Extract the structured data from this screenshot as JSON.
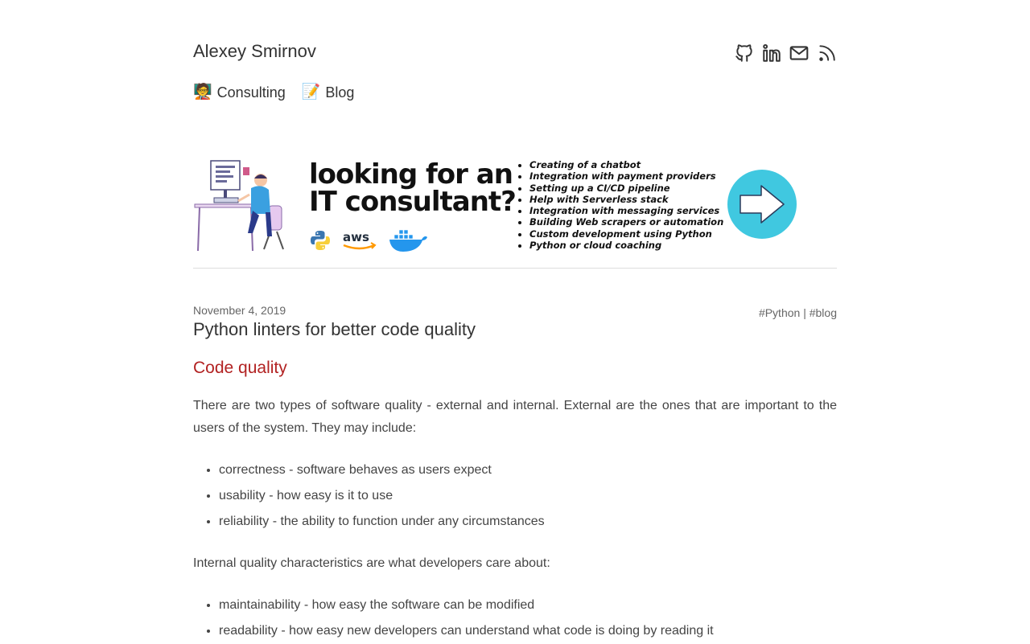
{
  "site": {
    "title": "Alexey Smirnov",
    "social": [
      "github-icon",
      "linkedin-icon",
      "mail-icon",
      "rss-icon"
    ],
    "nav": [
      {
        "emoji": "🧑‍🏫",
        "label": "Consulting"
      },
      {
        "emoji": "📝",
        "label": "Blog"
      }
    ]
  },
  "banner": {
    "headline_line1": "looking for an",
    "headline_line2": "IT consultant?",
    "services": [
      "Creating of a chatbot",
      "Integration with payment providers",
      "Setting up a CI/CD pipeline",
      "Help with Serverless stack",
      "Integration with messaging services",
      "Building Web scrapers or automation",
      "Custom development using Python",
      "Python or cloud coaching"
    ],
    "aws_text": "aws",
    "arrow_color": "#40c8e0"
  },
  "post": {
    "date": "November 4, 2019",
    "tags": [
      "#Python",
      "#blog"
    ],
    "tag_separator": "|",
    "title": "Python linters for better code quality",
    "section_heading": "Code quality",
    "paragraph1": "There are two types of software quality - external and internal. External are the ones that are important to the users of the system. They may include:",
    "list1": [
      "correctness - software behaves as users expect",
      "usability - how easy is it to use",
      "reliability - the ability to function under any circumstances"
    ],
    "paragraph2": "Internal quality characteristics are what developers care about:",
    "list2": [
      "maintainability - how easy the software can be modified",
      "readability - how easy new developers can understand what code is doing by reading it"
    ]
  },
  "colors": {
    "heading_accent": "#b22222",
    "text": "#444444"
  }
}
